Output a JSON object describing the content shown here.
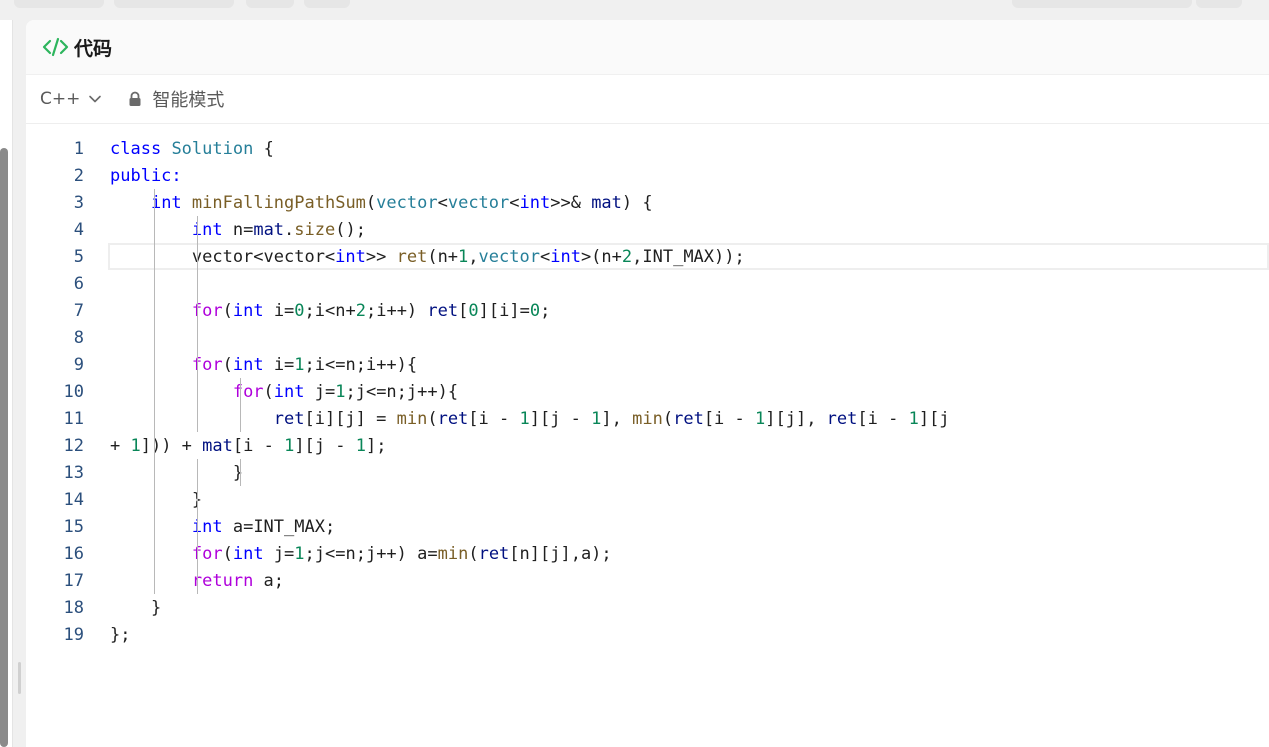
{
  "panel": {
    "title": "代码",
    "icon": "code-icon",
    "accent_color": "#2db55d"
  },
  "toolbar": {
    "language": "C++",
    "mode_label": "智能模式"
  },
  "editor": {
    "lines": [
      {
        "n": "1"
      },
      {
        "n": "2"
      },
      {
        "n": "3"
      },
      {
        "n": "4"
      },
      {
        "n": "5"
      },
      {
        "n": "6"
      },
      {
        "n": "7"
      },
      {
        "n": "8"
      },
      {
        "n": "9"
      },
      {
        "n": "10"
      },
      {
        "n": "11"
      },
      {
        "n": "12"
      },
      {
        "n": "13"
      },
      {
        "n": "14"
      },
      {
        "n": "15"
      },
      {
        "n": "16"
      },
      {
        "n": "17"
      },
      {
        "n": "18"
      },
      {
        "n": "19"
      }
    ],
    "code": [
      [
        [
          "kw",
          "class"
        ],
        [
          "nm",
          " "
        ],
        [
          "ty",
          "Solution"
        ],
        [
          "nm",
          " {"
        ]
      ],
      [
        [
          "kw",
          "public:"
        ]
      ],
      [
        [
          "nm",
          "    "
        ],
        [
          "kw",
          "int"
        ],
        [
          "nm",
          " "
        ],
        [
          "fn",
          "minFallingPathSum"
        ],
        [
          "nm",
          "("
        ],
        [
          "ty",
          "vector"
        ],
        [
          "nm",
          "<"
        ],
        [
          "ty",
          "vector"
        ],
        [
          "nm",
          "<"
        ],
        [
          "kw",
          "int"
        ],
        [
          "nm",
          ">>& "
        ],
        [
          "var",
          "mat"
        ],
        [
          "nm",
          ") {"
        ]
      ],
      [
        [
          "nm",
          "        "
        ],
        [
          "kw",
          "int"
        ],
        [
          "nm",
          " n="
        ],
        [
          "var",
          "mat"
        ],
        [
          "nm",
          "."
        ],
        [
          "fn",
          "size"
        ],
        [
          "nm",
          "();"
        ]
      ],
      [
        [
          "nm",
          "        vector<vector<"
        ],
        [
          "kw",
          "int"
        ],
        [
          "nm",
          ">> "
        ],
        [
          "fn",
          "ret"
        ],
        [
          "nm",
          "(n+"
        ],
        [
          "num",
          "1"
        ],
        [
          "nm",
          ","
        ],
        [
          "ty",
          "vector"
        ],
        [
          "nm",
          "<"
        ],
        [
          "kw",
          "int"
        ],
        [
          "nm",
          ">(n+"
        ],
        [
          "num",
          "2"
        ],
        [
          "nm",
          ",INT_MAX));"
        ]
      ],
      [
        [
          "nm",
          ""
        ]
      ],
      [
        [
          "nm",
          "        "
        ],
        [
          "ctl",
          "for"
        ],
        [
          "nm",
          "("
        ],
        [
          "kw",
          "int"
        ],
        [
          "nm",
          " i="
        ],
        [
          "num",
          "0"
        ],
        [
          "nm",
          ";i<n+"
        ],
        [
          "num",
          "2"
        ],
        [
          "nm",
          ";i++) "
        ],
        [
          "var",
          "ret"
        ],
        [
          "nm",
          "["
        ],
        [
          "num",
          "0"
        ],
        [
          "nm",
          "][i]="
        ],
        [
          "num",
          "0"
        ],
        [
          "nm",
          ";"
        ]
      ],
      [
        [
          "nm",
          ""
        ]
      ],
      [
        [
          "nm",
          "        "
        ],
        [
          "ctl",
          "for"
        ],
        [
          "nm",
          "("
        ],
        [
          "kw",
          "int"
        ],
        [
          "nm",
          " i="
        ],
        [
          "num",
          "1"
        ],
        [
          "nm",
          ";i<=n;i++){"
        ]
      ],
      [
        [
          "nm",
          "            "
        ],
        [
          "ctl",
          "for"
        ],
        [
          "nm",
          "("
        ],
        [
          "kw",
          "int"
        ],
        [
          "nm",
          " j="
        ],
        [
          "num",
          "1"
        ],
        [
          "nm",
          ";j<=n;j++){"
        ]
      ],
      [
        [
          "nm",
          "                "
        ],
        [
          "var",
          "ret"
        ],
        [
          "nm",
          "[i][j] = "
        ],
        [
          "fn",
          "min"
        ],
        [
          "nm",
          "("
        ],
        [
          "var",
          "ret"
        ],
        [
          "nm",
          "[i - "
        ],
        [
          "num",
          "1"
        ],
        [
          "nm",
          "][j - "
        ],
        [
          "num",
          "1"
        ],
        [
          "nm",
          "], "
        ],
        [
          "fn",
          "min"
        ],
        [
          "nm",
          "("
        ],
        [
          "var",
          "ret"
        ],
        [
          "nm",
          "[i - "
        ],
        [
          "num",
          "1"
        ],
        [
          "nm",
          "][j], "
        ],
        [
          "var",
          "ret"
        ],
        [
          "nm",
          "[i - "
        ],
        [
          "num",
          "1"
        ],
        [
          "nm",
          "][j"
        ]
      ],
      [
        [
          "nm",
          "+ "
        ],
        [
          "num",
          "1"
        ],
        [
          "nm",
          "])) + "
        ],
        [
          "var",
          "mat"
        ],
        [
          "nm",
          "[i - "
        ],
        [
          "num",
          "1"
        ],
        [
          "nm",
          "][j - "
        ],
        [
          "num",
          "1"
        ],
        [
          "nm",
          "];"
        ]
      ],
      [
        [
          "nm",
          "            }"
        ]
      ],
      [
        [
          "nm",
          "        }"
        ]
      ],
      [
        [
          "nm",
          "        "
        ],
        [
          "kw",
          "int"
        ],
        [
          "nm",
          " a=INT_MAX;"
        ]
      ],
      [
        [
          "nm",
          "        "
        ],
        [
          "ctl",
          "for"
        ],
        [
          "nm",
          "("
        ],
        [
          "kw",
          "int"
        ],
        [
          "nm",
          " j="
        ],
        [
          "num",
          "1"
        ],
        [
          "nm",
          ";j<=n;j++) a="
        ],
        [
          "fn",
          "min"
        ],
        [
          "nm",
          "("
        ],
        [
          "var",
          "ret"
        ],
        [
          "nm",
          "[n][j],a);"
        ]
      ],
      [
        [
          "nm",
          "        "
        ],
        [
          "ctl",
          "return"
        ],
        [
          "nm",
          " a;"
        ]
      ],
      [
        [
          "nm",
          "    }"
        ]
      ],
      [
        [
          "nm",
          "};"
        ]
      ]
    ]
  }
}
